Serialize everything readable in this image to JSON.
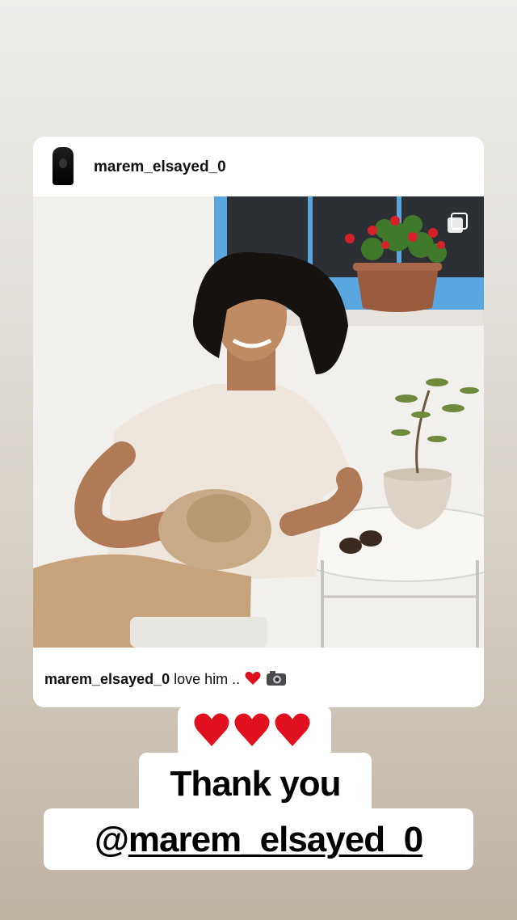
{
  "post": {
    "username": "marem_elsayed_0",
    "caption_user": "marem_elsayed_0",
    "caption_text": " love him ..",
    "image_alt": "Smiling man with long curly hair holding a straw hat, seated at a white table with potted plants",
    "photo_icons": [
      "multiple-photos-icon"
    ]
  },
  "story": {
    "hearts": [
      "❤️",
      "❤️",
      "❤️"
    ],
    "thanks_text": "Thank you",
    "mention_at": "@",
    "mention_name": "marem_elsayed_0"
  },
  "colors": {
    "heart": "#e0101e",
    "window_frame": "#5aa6e0",
    "wall": "#f2f0ec"
  }
}
